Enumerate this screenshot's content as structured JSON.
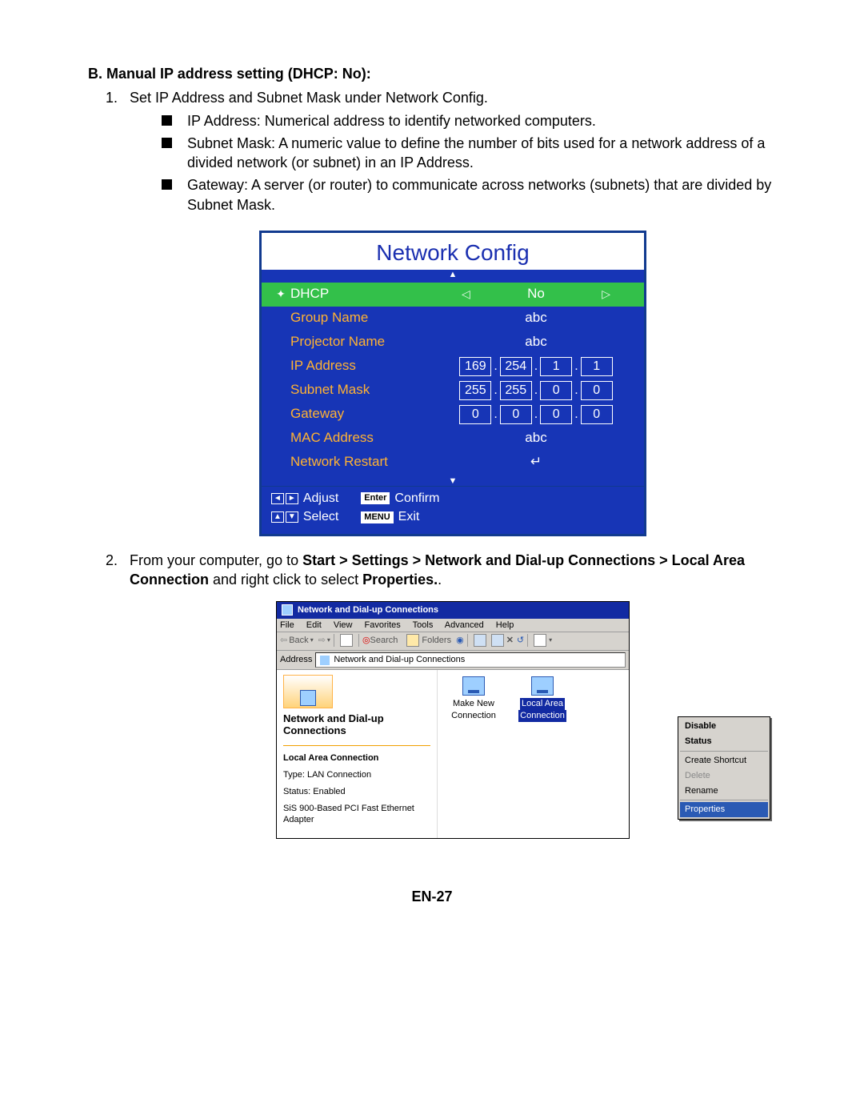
{
  "doc": {
    "section_title": "B. Manual IP address setting (DHCP: No):",
    "step1_intro": "Set IP Address and Subnet Mask under Network Config.",
    "step1_bullets": [
      "IP Address: Numerical address to identify networked computers.",
      "Subnet Mask: A numeric value to define the number of bits used for a network address of a divided network (or subnet) in an IP Address.",
      "Gateway: A server (or router) to communicate across networks (subnets) that are divided by Subnet Mask."
    ],
    "step2_pre": "From your computer, go to ",
    "step2_bold": "Start > Settings > Network and Dial-up Connections > Local Area Connection",
    "step2_mid": " and right click to select ",
    "step2_bold2": "Properties.",
    "step2_tail": "."
  },
  "osd": {
    "title": "Network Config",
    "rows": {
      "dhcp": {
        "label": "DHCP",
        "left_ar": "◁",
        "value": "No",
        "right_ar": "▷"
      },
      "group": {
        "label": "Group Name",
        "value": "abc"
      },
      "proj": {
        "label": "Projector Name",
        "value": "abc"
      },
      "ipaddr": {
        "label": "IP Address",
        "cells": [
          "169",
          "254",
          "1",
          "1"
        ]
      },
      "subnet": {
        "label": "Subnet Mask",
        "cells": [
          "255",
          "255",
          "0",
          "0"
        ]
      },
      "gateway": {
        "label": "Gateway",
        "cells": [
          "0",
          "0",
          "0",
          "0"
        ]
      },
      "mac": {
        "label": "MAC Address",
        "value": "abc"
      },
      "restart": {
        "label": "Network Restart",
        "value": "↵"
      }
    },
    "footer": {
      "adjust": "Adjust",
      "select": "Select",
      "enter": "Enter",
      "confirm": "Confirm",
      "menu": "MENU",
      "exit": "Exit"
    }
  },
  "win": {
    "title": "Network and Dial-up Connections",
    "menus": [
      "File",
      "Edit",
      "View",
      "Favorites",
      "Tools",
      "Advanced",
      "Help"
    ],
    "toolbar": {
      "back": "Back",
      "search": "Search",
      "folders": "Folders"
    },
    "addr_label": "Address",
    "addr_value": "Network and Dial-up Connections",
    "left_title": "Network and Dial-up Connections",
    "left_lines": {
      "name_label": "Local Area Connection",
      "type": "Type: LAN Connection",
      "status": "Status: Enabled",
      "adapter": "SiS 900-Based PCI Fast Ethernet Adapter"
    },
    "items": {
      "make_new": "Make New Connection",
      "lac_top": "Local Area",
      "lac_bottom": "Connection"
    },
    "ctx": {
      "disable": "Disable",
      "status": "Status",
      "shortcut": "Create Shortcut",
      "delete": "Delete",
      "rename": "Rename",
      "properties": "Properties"
    }
  },
  "page_num": "EN-27"
}
